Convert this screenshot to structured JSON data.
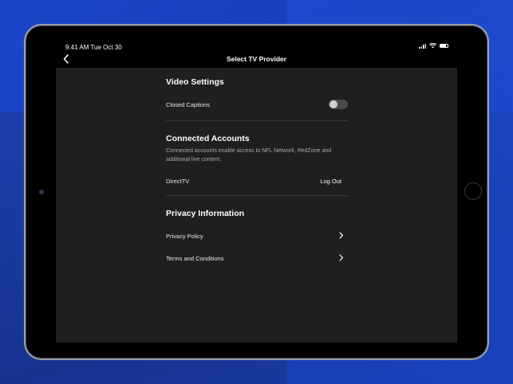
{
  "status_bar": {
    "time": "9:41 AM  Tue Oct 30"
  },
  "nav": {
    "title": "Select TV Provider",
    "back_icon": "chevron-left-icon"
  },
  "video_settings": {
    "title": "Video Settings",
    "closed_captions_label": "Closed Captions",
    "closed_captions_on": false
  },
  "connected_accounts": {
    "title": "Connected Accounts",
    "description": "Connected accounts enable access to NFL Network, RedZone and additional live content.",
    "provider_name": "DirectTV",
    "logout_label": "Log Out"
  },
  "privacy": {
    "title": "Privacy Information",
    "items": [
      {
        "label": "Privacy Policy"
      },
      {
        "label": "Terms and Conditions"
      }
    ]
  },
  "colors": {
    "background_blue": "#1a47c8",
    "content_bg": "#1f1f1f",
    "text": "#ffffff"
  }
}
